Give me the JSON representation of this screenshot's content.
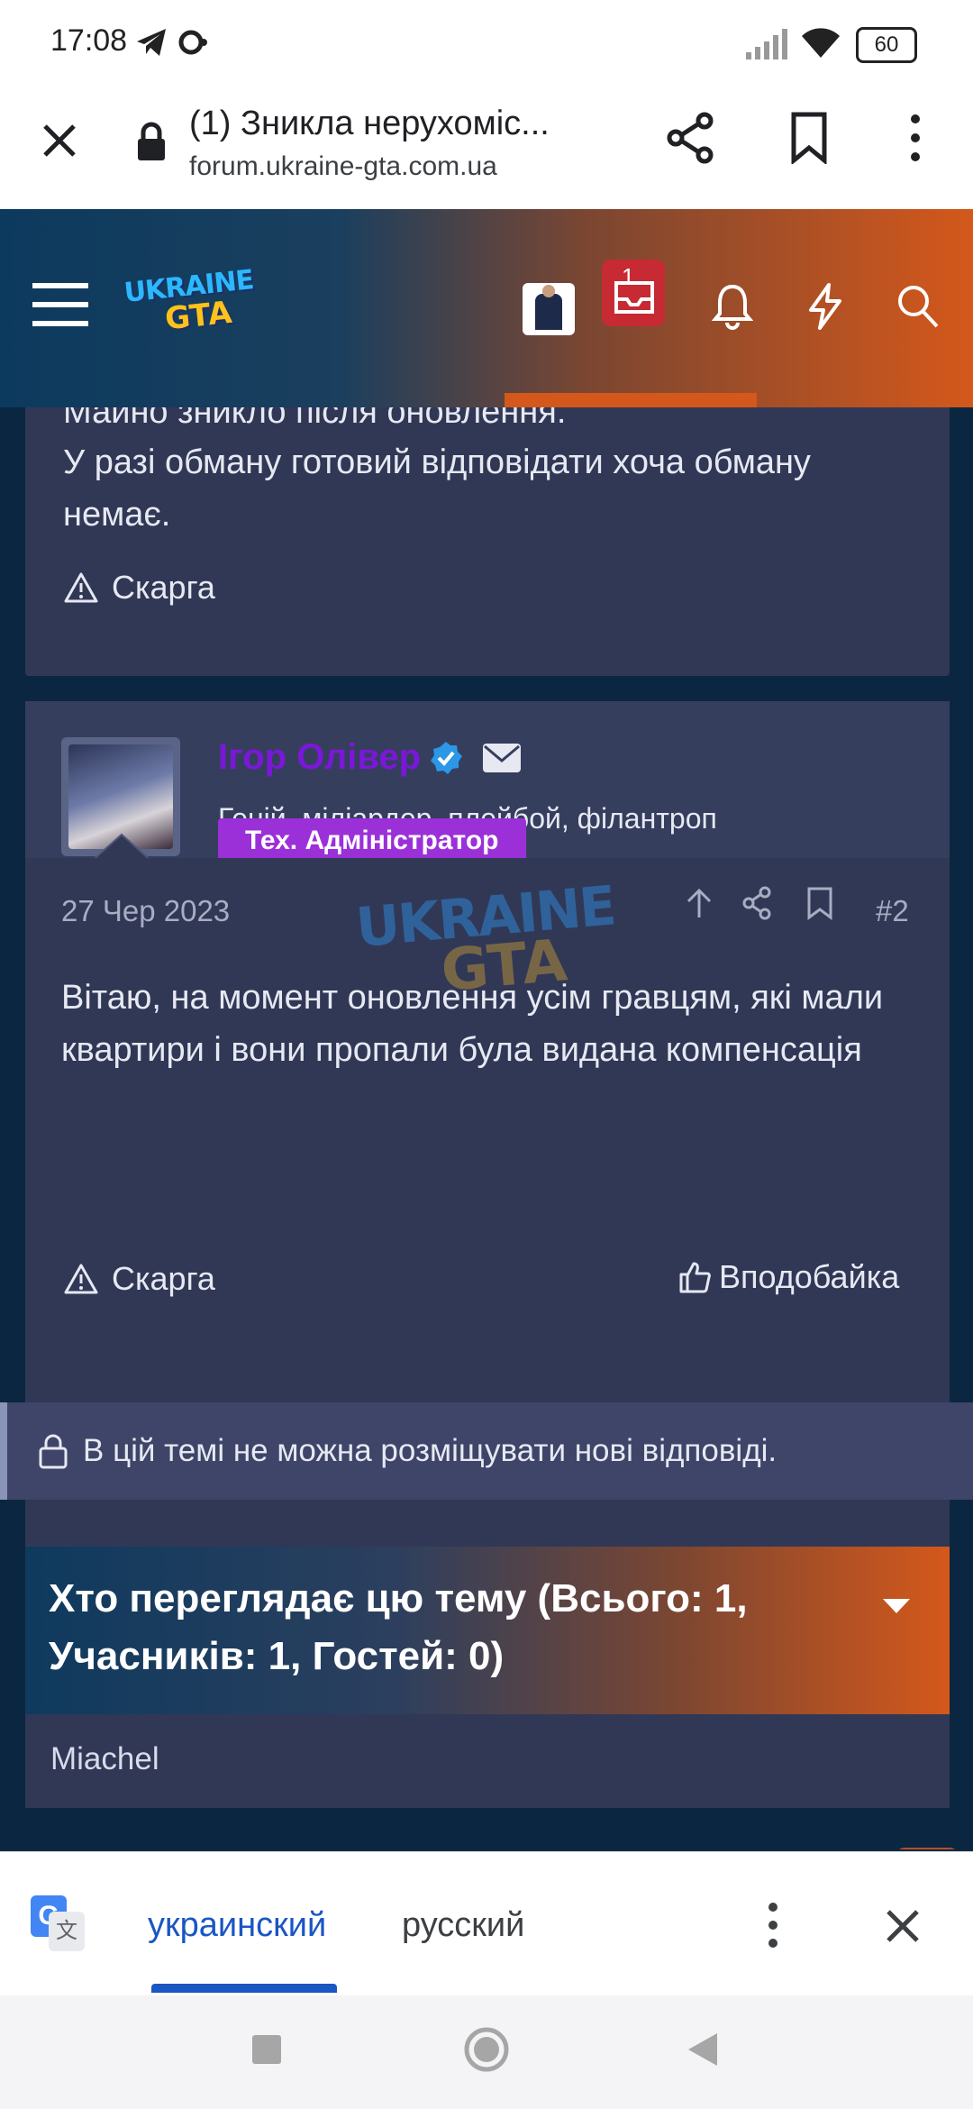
{
  "status_bar": {
    "time": "17:08",
    "battery": "60"
  },
  "browser": {
    "tab_title": "(1) Зникла нерухоміс...",
    "url": "forum.ukraine-gta.com.ua"
  },
  "header": {
    "logo_line1": "UKRAINE",
    "logo_line2": "GTA",
    "notifications_count": "1"
  },
  "post1": {
    "text_cut": "Майно зникло після оновлення.",
    "text": "У разі обману готовий відповідати хоча обману немає.",
    "report_label": "Скарга"
  },
  "post2": {
    "author": "Ігор Олівер",
    "user_title": "Геній, міліардер, плейбой, філантроп",
    "role_badge": "Тех. Адміністратор",
    "date": "27 Чер 2023",
    "post_number": "#2",
    "text": "Вітаю, на момент оновлення усім гравцям, які мали квартири і вони пропали була видана компенсація",
    "report_label": "Скарга",
    "like_label": "Вподобайка"
  },
  "locked_notice": "В цій темі не можна розміщувати нові відповіді.",
  "viewers": {
    "title": "Хто переглядає цю тему (Всього: 1, Учасників: 1, Гостей: 0)",
    "users": [
      "Miachel"
    ]
  },
  "translate_bar": {
    "lang_active": "украинский",
    "lang_other": "русский"
  },
  "colors": {
    "accent_orange": "#d4581b",
    "header_blue": "#0c3a5e",
    "card": "#313856",
    "admin_badge": "#9b30d9",
    "translate_active": "#1a56c4"
  }
}
